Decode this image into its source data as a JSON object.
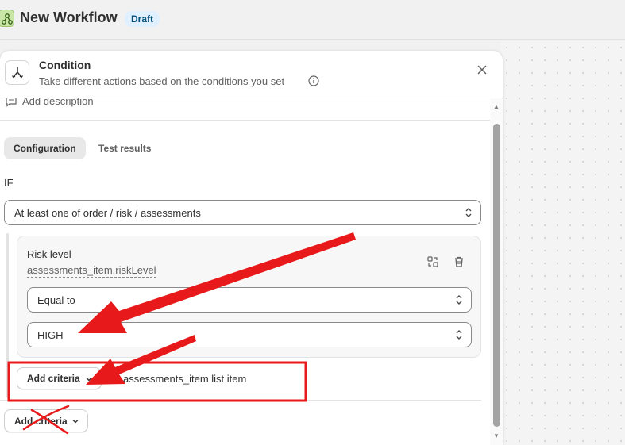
{
  "workflow": {
    "title": "New Workflow",
    "status_badge": "Draft"
  },
  "panel": {
    "title": "Condition",
    "subtitle": "Take different actions based on the conditions you set",
    "add_description": "Add description",
    "tabs": [
      {
        "label": "Configuration",
        "active": true
      },
      {
        "label": "Test results",
        "active": false
      }
    ],
    "if_label": "IF",
    "scope_select": "At least one of order / risk / assessments",
    "criteria": {
      "label": "Risk level",
      "path": "assessments_item.riskLevel",
      "operator": "Equal to",
      "value": "HIGH"
    },
    "inner_add_criteria": "Add criteria",
    "inner_add_suffix": "assessments_item list item",
    "outer_add_criteria": "Add criteria"
  },
  "annotations": {
    "arrow_color": "#e8191b",
    "box_color": "#e8191b"
  },
  "colors": {
    "badge_bg": "#e0f0ff",
    "badge_text": "#00527c",
    "app_icon": "#c9e6a6"
  }
}
